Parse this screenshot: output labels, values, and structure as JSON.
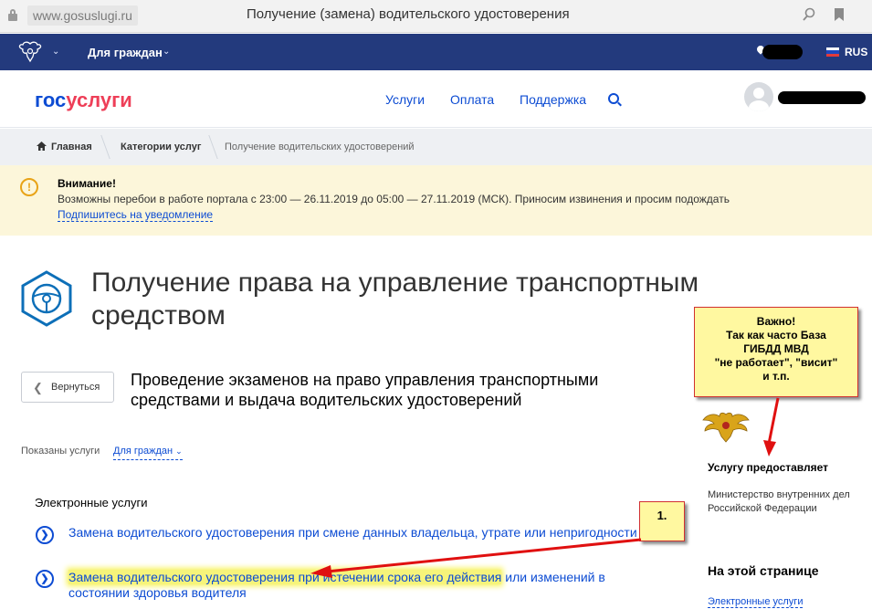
{
  "browser": {
    "url": "www.gosuslugi.ru",
    "tab_title": "Получение (замена) водительского удостоверения",
    "icons": [
      "lock-icon",
      "search-icon",
      "bookmark-icon"
    ]
  },
  "topbar": {
    "for_citizens": "Для граждан",
    "lang": "RUS",
    "bg": "#233a7d"
  },
  "header": {
    "logo_part1": "гос",
    "logo_part2": "услуги",
    "nav": [
      "Услуги",
      "Оплата",
      "Поддержка"
    ]
  },
  "breadcrumbs": [
    "Главная",
    "Категории услуг",
    "Получение водительских удостоверений"
  ],
  "warning": {
    "title": "Внимание!",
    "text": "Возможны перебои в работе портала с 23:00 — 26.11.2019 до 05:00 — 27.11.2019 (МСК). Приносим извинения и просим подождать",
    "link": "Подпишитесь на уведомление"
  },
  "main": {
    "title_line1": "Получение права на управление транспортным",
    "title_line2": "средством",
    "back": "Вернуться",
    "subtitle_line1": "Проведение экзаменов на право управления транспортными",
    "subtitle_line2": "средствами и выдача водительских удостоверений",
    "shown_label": "Показаны услуги",
    "shown_value": "Для граждан",
    "electronic_services": "Электронные услуги",
    "service1": "Замена водительского удостоверения при смене данных владельца, утрате или непригодности",
    "service2_highlight": "Замена водительского удостоверения при истечении срока его действия",
    "service2_rest": " или изменений в",
    "service2_line2": "состоянии здоровья водителя"
  },
  "sidebar": {
    "note_lines": [
      "Важно!",
      "Так как часто База",
      "ГИБДД МВД",
      "\"не работает\", \"висит\"",
      "и т.п."
    ],
    "provider_heading": "Услугу предоставляет",
    "provider_line1": "Министерство внутренних дел",
    "provider_line2": "Российской Федерации",
    "on_page_heading": "На этой странице",
    "on_page_link": "Электронные услуги"
  },
  "annotation": {
    "step": "1."
  },
  "colors": {
    "link": "#0d4cd3",
    "logo_red": "#ee3f58",
    "warning_bg": "#fcf6da",
    "highlight": "#f6f47a",
    "arrow": "#e01010"
  }
}
